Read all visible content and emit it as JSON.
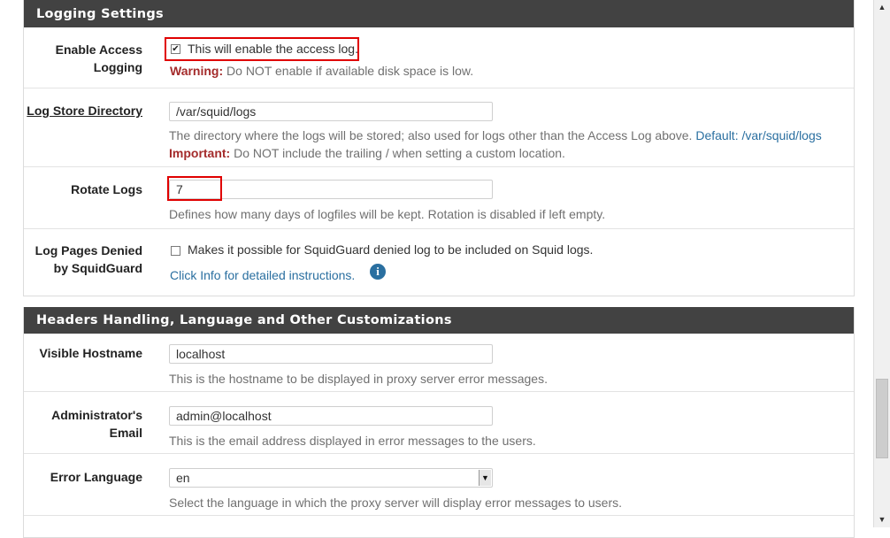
{
  "logging": {
    "heading": "Logging Settings",
    "enable_access": {
      "label": "Enable Access Logging",
      "label_line1": "Enable Access",
      "label_line2": "Logging",
      "checkbox_checked": true,
      "checkbox_text": "This will enable the access log.",
      "warning_prefix": "Warning:",
      "warning_text": " Do NOT enable if available disk space is low."
    },
    "log_store": {
      "label": "Log Store Directory",
      "value": "/var/squid/logs",
      "help": "The directory where the logs will be stored; also used for logs other than the Access Log above.",
      "default_text": " Default: /var/squid/logs",
      "important_prefix": "Important:",
      "important_text": " Do NOT include the trailing / when setting a custom location."
    },
    "rotate": {
      "label": "Rotate Logs",
      "value": "7",
      "help": "Defines how many days of logfiles will be kept. Rotation is disabled if left empty."
    },
    "squidguard": {
      "label_line1": "Log Pages Denied",
      "label_line2": "by SquidGuard",
      "checkbox_checked": false,
      "checkbox_text": "Makes it possible for SquidGuard denied log to be included on Squid logs.",
      "info_link": "Click Info for detailed instructions.",
      "info_icon": "i"
    }
  },
  "headers": {
    "heading": "Headers Handling, Language and Other Customizations",
    "hostname": {
      "label": "Visible Hostname",
      "value": "localhost",
      "help": "This is the hostname to be displayed in proxy server error messages."
    },
    "admin_email": {
      "label_line1": "Administrator's",
      "label_line2": "Email",
      "value": "admin@localhost",
      "help": "This is the email address displayed in error messages to the users."
    },
    "error_language": {
      "label": "Error Language",
      "value": "en",
      "help": "Select the language in which the proxy server will display error messages to users."
    }
  },
  "colors": {
    "heading_bg": "#424242",
    "warning": "#a42b2b",
    "link": "#2a6fa0",
    "highlight": "#e00000"
  }
}
